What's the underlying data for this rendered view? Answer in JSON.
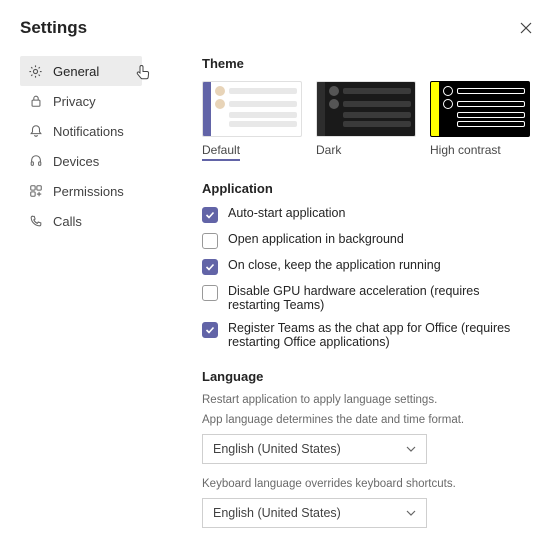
{
  "title": "Settings",
  "sidebar": {
    "items": [
      {
        "label": "General"
      },
      {
        "label": "Privacy"
      },
      {
        "label": "Notifications"
      },
      {
        "label": "Devices"
      },
      {
        "label": "Permissions"
      },
      {
        "label": "Calls"
      }
    ]
  },
  "theme": {
    "heading": "Theme",
    "options": [
      {
        "label": "Default"
      },
      {
        "label": "Dark"
      },
      {
        "label": "High contrast"
      }
    ]
  },
  "application": {
    "heading": "Application",
    "items": [
      {
        "label": "Auto-start application",
        "checked": true
      },
      {
        "label": "Open application in background",
        "checked": false
      },
      {
        "label": "On close, keep the application running",
        "checked": true
      },
      {
        "label": "Disable GPU hardware acceleration (requires restarting Teams)",
        "checked": false
      },
      {
        "label": "Register Teams as the chat app for Office (requires restarting Office applications)",
        "checked": true
      }
    ]
  },
  "language": {
    "heading": "Language",
    "restart_note": "Restart application to apply language settings.",
    "app_lang_note": "App language determines the date and time format.",
    "app_lang_value": "English (United States)",
    "keyboard_note": "Keyboard language overrides keyboard shortcuts.",
    "keyboard_value": "English (United States)"
  }
}
